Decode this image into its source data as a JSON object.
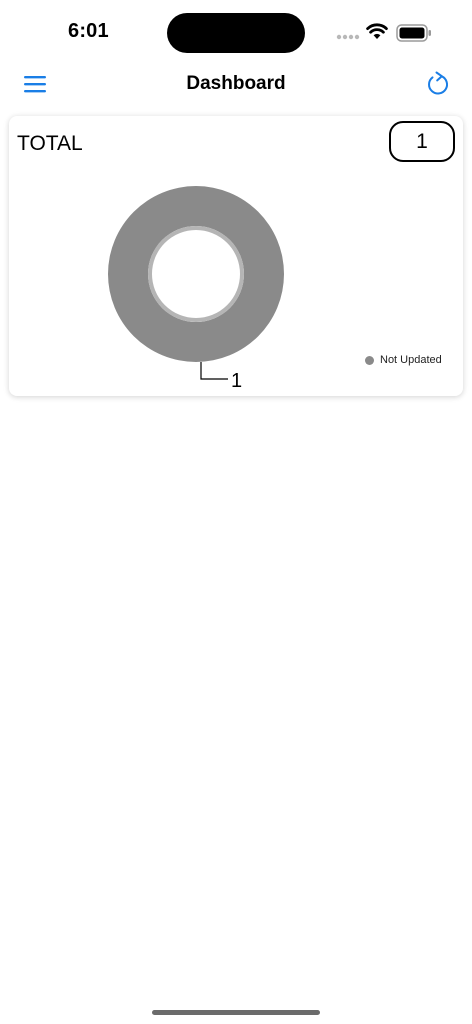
{
  "status_bar": {
    "time": "6:01"
  },
  "nav": {
    "title": "Dashboard",
    "menu_icon": "hamburger-menu-icon",
    "refresh_icon": "refresh-icon",
    "accent_color": "#1a7ee6"
  },
  "card": {
    "title": "TOTAL",
    "count": "1"
  },
  "chart_data": {
    "type": "pie",
    "donut": true,
    "title": "",
    "categories": [
      "Not Updated"
    ],
    "values": [
      1
    ],
    "colors": [
      "#8a8a8a"
    ],
    "data_labels": [
      "1"
    ],
    "legend": {
      "placement": "bottom-right",
      "entries": [
        "Not Updated"
      ]
    }
  }
}
